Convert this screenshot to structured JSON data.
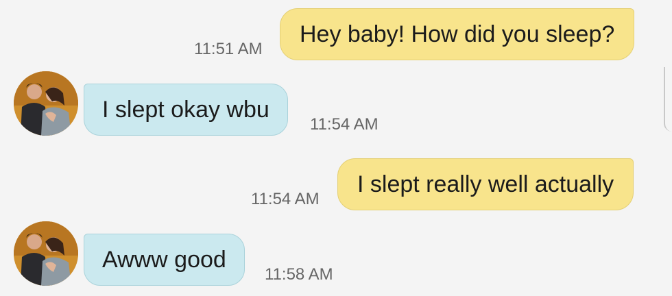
{
  "conversation": {
    "messages": [
      {
        "direction": "outgoing",
        "text": "Hey baby! How did you sleep?",
        "time": "11:51 AM"
      },
      {
        "direction": "incoming",
        "text": "I slept okay wbu",
        "time": "11:54 AM",
        "avatar_icon": "couple-photo-avatar"
      },
      {
        "direction": "outgoing",
        "text": "I slept really well actually",
        "time": "11:54 AM"
      },
      {
        "direction": "incoming",
        "text": "Awww good",
        "time": "11:58 AM",
        "avatar_icon": "couple-photo-avatar"
      }
    ]
  },
  "colors": {
    "background": "#f4f4f4",
    "outgoing_bubble": "#f8e48c",
    "incoming_bubble": "#cbe9ef",
    "timestamp_text": "#666666",
    "avatar_ring": "#cf8f2d"
  }
}
